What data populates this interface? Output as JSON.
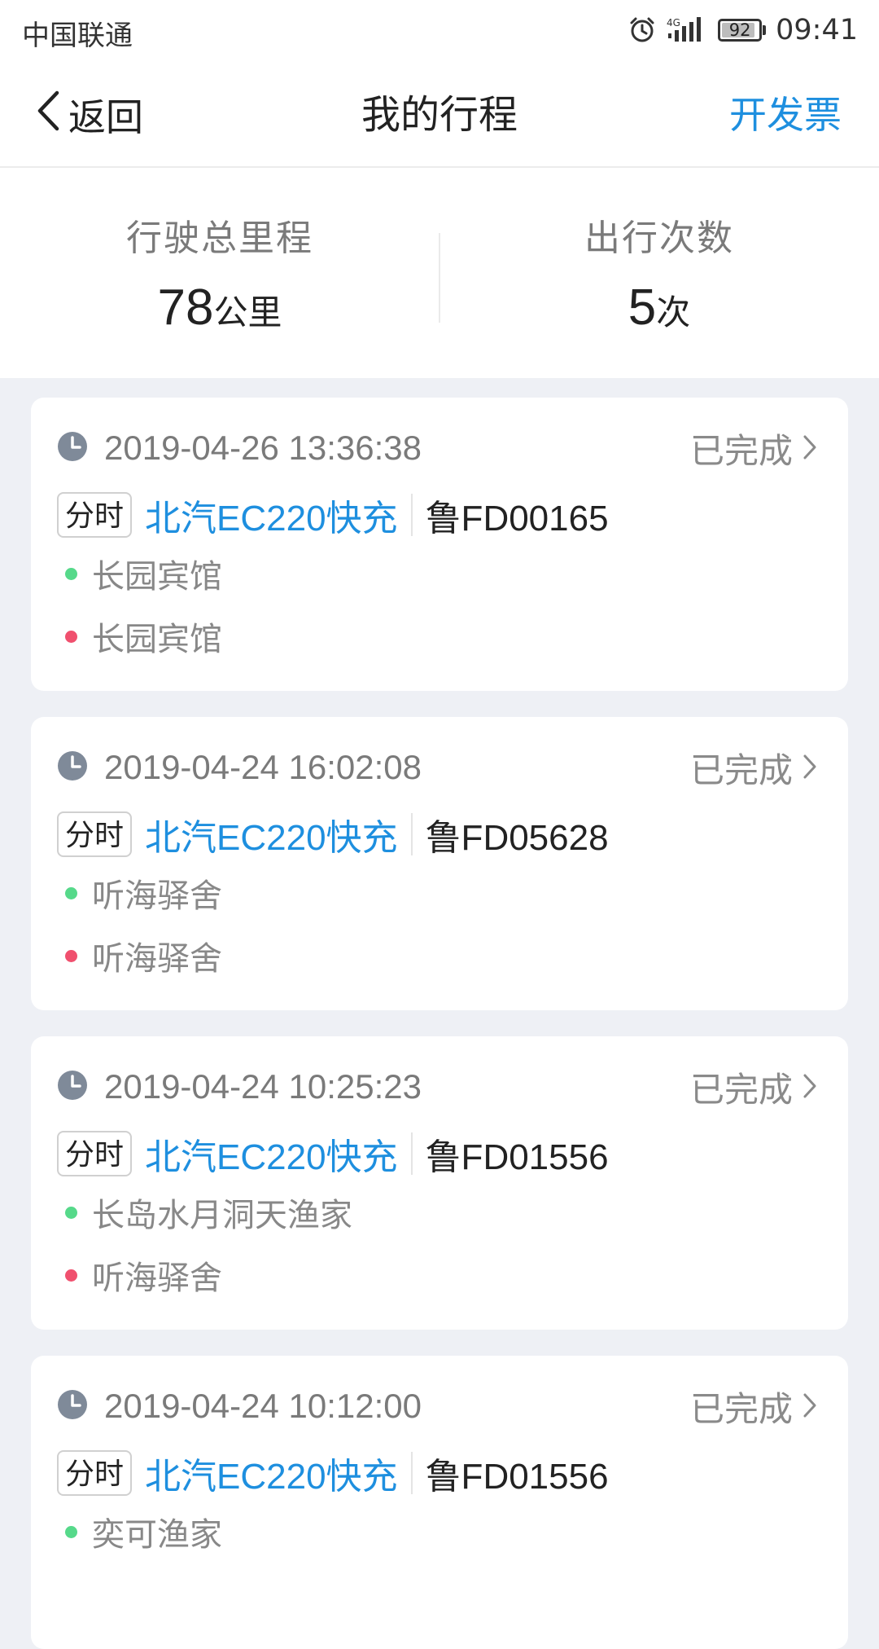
{
  "status_bar": {
    "carrier": "中国联通",
    "network": "4G",
    "battery": 92,
    "time": "09:41"
  },
  "nav": {
    "back_label": "返回",
    "title": "我的行程",
    "action_label": "开发票"
  },
  "summary": {
    "distance_label": "行驶总里程",
    "distance_value": "78",
    "distance_unit": "公里",
    "trips_label": "出行次数",
    "trips_value": "5",
    "trips_unit": "次"
  },
  "colors": {
    "accent": "#1e8fdf",
    "start_dot": "#56d98a",
    "end_dot": "#f0506e",
    "clock_icon": "#7f8a99"
  },
  "icons": {
    "back": "chevron-left-icon",
    "time": "clock-icon",
    "status": "chevron-right-icon",
    "alarm": "alarm-icon",
    "signal": "signal-icon"
  },
  "trips": [
    {
      "time": "2019-04-26 13:36:38",
      "status": "已完成",
      "tag": "分时",
      "model": "北汽EC220快充",
      "plate": "鲁FD00165",
      "start": "长园宾馆",
      "end": "长园宾馆"
    },
    {
      "time": "2019-04-24 16:02:08",
      "status": "已完成",
      "tag": "分时",
      "model": "北汽EC220快充",
      "plate": "鲁FD05628",
      "start": "听海驿舍",
      "end": "听海驿舍"
    },
    {
      "time": "2019-04-24 10:25:23",
      "status": "已完成",
      "tag": "分时",
      "model": "北汽EC220快充",
      "plate": "鲁FD01556",
      "start": "长岛水月洞天渔家",
      "end": "听海驿舍"
    },
    {
      "time": "2019-04-24 10:12:00",
      "status": "已完成",
      "tag": "分时",
      "model": "北汽EC220快充",
      "plate": "鲁FD01556",
      "start": "奕可渔家"
    }
  ]
}
